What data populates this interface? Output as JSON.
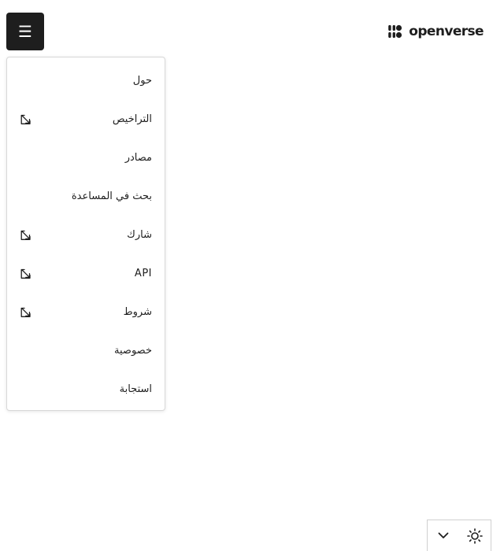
{
  "header": {
    "menu_glyph": "☰",
    "logo_text": "openverse"
  },
  "menu": {
    "items": [
      {
        "label": "حول",
        "external": false
      },
      {
        "label": "التراخيص",
        "external": true
      },
      {
        "label": "مصادر",
        "external": false
      },
      {
        "label": "بحث في المساعدة",
        "external": false
      },
      {
        "label": "شارك",
        "external": true
      },
      {
        "label": "API",
        "external": true
      },
      {
        "label": "شروط",
        "external": true
      },
      {
        "label": "خصوصية",
        "external": false
      },
      {
        "label": "استجابة",
        "external": false
      }
    ]
  },
  "controls": {
    "items": [
      {
        "icon": "chevron-down-icon"
      },
      {
        "icon": "sun-icon"
      }
    ]
  },
  "colors": {
    "menu_button_bg": "#1e1e1e",
    "text": "#1e1e1e",
    "panel_border": "#d8d8d8"
  }
}
